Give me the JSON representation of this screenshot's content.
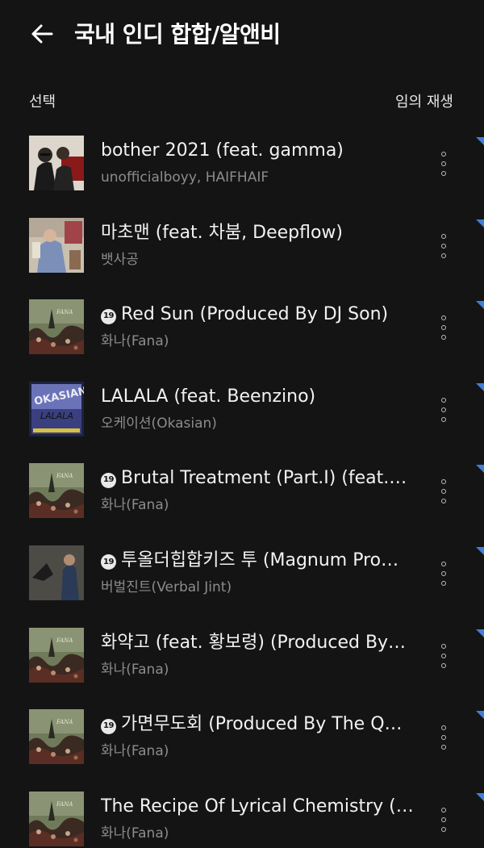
{
  "header": {
    "title": "국내 인디 합합/알앤비",
    "back_icon": "arrow-left-icon"
  },
  "toolbar": {
    "select_label": "선택",
    "shuffle_label": "임의 재생"
  },
  "explicit_badge": "19",
  "colors": {
    "background": "#141414",
    "title_text": "#f2f2f2",
    "artist_text": "#8c8c8c",
    "corner_accent": "#3d7fd9"
  },
  "tracks": [
    {
      "title": "bother 2021 (feat. gamma)",
      "artist": "unofficialboyy, HAIFHAIF",
      "explicit": false
    },
    {
      "title": "마초맨 (feat. 차붐, Deepflow)",
      "artist": "뱃사공",
      "explicit": false
    },
    {
      "title": "Red Sun (Produced By DJ Son)",
      "artist": "화나(Fana)",
      "explicit": true
    },
    {
      "title": "LALALA (feat. Beenzino)",
      "artist": "오케이션(Okasian)",
      "explicit": false
    },
    {
      "title": "Brutal Treatment (Part.I) (feat.…",
      "artist": "화나(Fana)",
      "explicit": true
    },
    {
      "title": "투올더힙합키즈 투 (Magnum Pro…",
      "artist": "버벌진트(Verbal Jint)",
      "explicit": true
    },
    {
      "title": "화약고 (feat. 황보령) (Produced By…",
      "artist": "화나(Fana)",
      "explicit": false
    },
    {
      "title": "가면무도회 (Produced By The Q…",
      "artist": "화나(Fana)",
      "explicit": true
    },
    {
      "title": "The Recipe Of Lyrical Chemistry (…",
      "artist": "화나(Fana)",
      "explicit": false
    }
  ]
}
